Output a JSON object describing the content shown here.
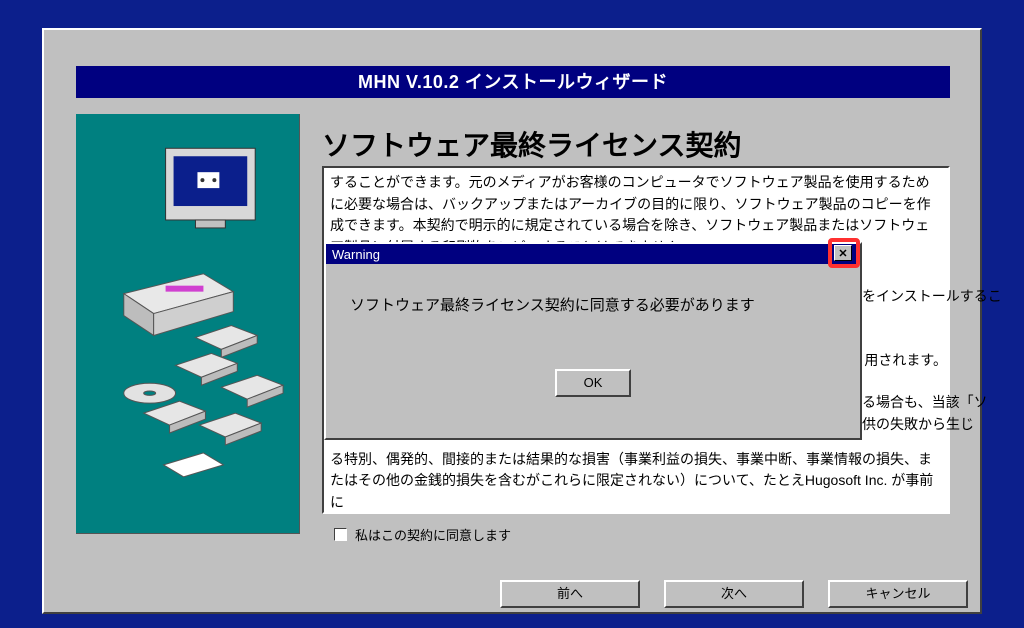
{
  "title": "MHN V.10.2 インストールウィザード",
  "heading": "ソフトウェア最終ライセンス契約",
  "eula_top": "することができます。元のメディアがお客様のコンピュータでソフトウェア製品を使用するために必要な場合は、バックアップまたはアーカイブの目的に限り、ソフトウェア製品のコピーを作成できます。本契約で明示的に規定されている場合を除き、ソフトウェア製品またはソフトウェア製品に付属する印刷物をコピーすることはできません。",
  "eula_peek_a": "をインストールするこ",
  "eula_peek_b": "用されます。",
  "eula_peek_c1": "る場合も、当該「ソ",
  "eula_peek_c2": "供の失敗から生じ",
  "eula_bottom": "る特別、偶発的、間接的または結果的な損害（事業利益の損失、事業中断、事業情報の損失、またはその他の金銭的損失を含むがこれらに限定されない）について、たとえHugosoft Inc. が事前に",
  "checkbox_label": "私はこの契約に同意します",
  "buttons": {
    "prev": "前へ",
    "next": "次へ",
    "cancel": "キャンセル"
  },
  "warning": {
    "title": "Warning",
    "message": "ソフトウェア最終ライセンス契約に同意する必要があります",
    "ok": "OK",
    "close_icon": "✕"
  }
}
